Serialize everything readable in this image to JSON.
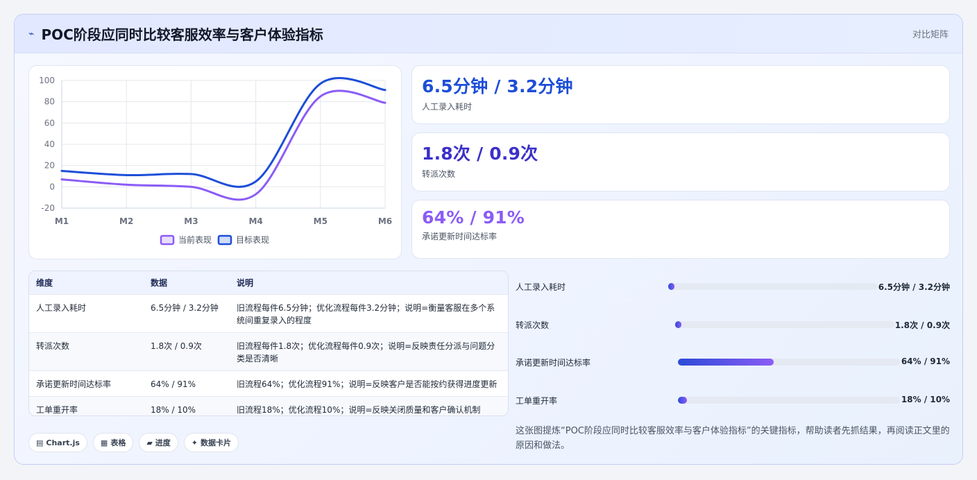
{
  "header": {
    "icon": "trend-icon",
    "title": "POC阶段应同时比较客服效率与客户体验指标",
    "right_label": "对比矩阵"
  },
  "stats": [
    {
      "value": "6.5分钟 / 3.2分钟",
      "label": "人工录入耗时",
      "color": "#1d4ed8"
    },
    {
      "value": "1.8次 / 0.9次",
      "label": "转派次数",
      "color": "#3b30c9"
    },
    {
      "value": "64% / 91%",
      "label": "承诺更新时间达标率",
      "color": "#8b5cf6"
    }
  ],
  "table": {
    "headers": [
      "维度",
      "数据",
      "说明"
    ],
    "rows": [
      [
        "人工录入耗时",
        "6.5分钟 / 3.2分钟",
        "旧流程每件6.5分钟；优化流程每件3.2分钟；说明=衡量客服在多个系统间重复录入的程度"
      ],
      [
        "转派次数",
        "1.8次 / 0.9次",
        "旧流程每件1.8次；优化流程每件0.9次；说明=反映责任分派与问题分类是否清晰"
      ],
      [
        "承诺更新时间达标率",
        "64% / 91%",
        "旧流程64%；优化流程91%；说明=反映客户是否能按约获得进度更新"
      ],
      [
        "工单重开率",
        "18% / 10%",
        "旧流程18%；优化流程10%；说明=反映关闭质量和客户确认机制"
      ]
    ]
  },
  "bars": [
    {
      "label": "人工录入耗时",
      "value": "6.5分钟 / 3.2分钟",
      "fill_pct": 2
    },
    {
      "label": "转派次数",
      "value": "1.8次 / 0.9次",
      "fill_pct": 2
    },
    {
      "label": "承诺更新时间达标率",
      "value": "64% / 91%",
      "fill_pct": 43
    },
    {
      "label": "工单重开率",
      "value": "18% / 10%",
      "fill_pct": 4
    }
  ],
  "chips": [
    {
      "icon": "chart-icon",
      "glyph": "▤",
      "label": "Chart.js"
    },
    {
      "icon": "table-icon",
      "glyph": "▦",
      "label": "表格"
    },
    {
      "icon": "progress-icon",
      "glyph": "▰",
      "label": "进度"
    },
    {
      "icon": "sparkle-icon",
      "glyph": "✦",
      "label": "数据卡片"
    }
  ],
  "summary": "这张图提炼“POC阶段应同时比较客服效率与客户体验指标”的关键指标，帮助读者先抓结果，再阅读正文里的原因和做法。",
  "chart_data": {
    "type": "line",
    "categories": [
      "M1",
      "M2",
      "M3",
      "M4",
      "M5",
      "M6"
    ],
    "series": [
      {
        "name": "当前表现",
        "values": [
          7,
          2,
          0,
          -7,
          85,
          79
        ],
        "color": "#8b5cf6"
      },
      {
        "name": "目标表现",
        "values": [
          15,
          11,
          12,
          5,
          97,
          91
        ],
        "color": "#1d4ed8"
      }
    ],
    "yticks": [
      100,
      80,
      60,
      40,
      20,
      0,
      -20
    ],
    "ylim": [
      -20,
      100
    ],
    "grid": true,
    "legend": "bottom"
  }
}
